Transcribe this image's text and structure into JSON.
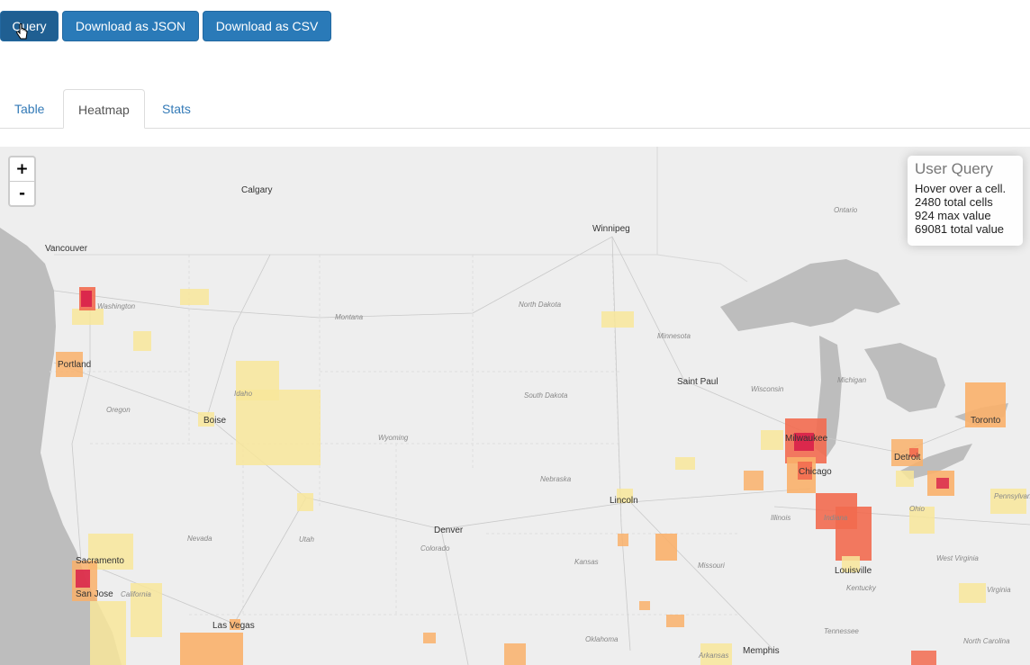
{
  "toolbar": {
    "query_label": "Query",
    "json_label": "Download as JSON",
    "csv_label": "Download as CSV"
  },
  "tabs": [
    {
      "label": "Table",
      "active": false
    },
    {
      "label": "Heatmap",
      "active": true
    },
    {
      "label": "Stats",
      "active": false
    }
  ],
  "map": {
    "zoom_in_label": "+",
    "zoom_out_label": "-",
    "info": {
      "title": "User Query",
      "hint": "Hover over a cell.",
      "cells": "2480 total cells",
      "max": "924 max value",
      "total": "69081 total value"
    },
    "cities": [
      "Calgary",
      "Winnipeg",
      "Vancouver",
      "Portland",
      "Boise",
      "Saint Paul",
      "Milwaukee",
      "Chicago",
      "Detroit",
      "Toronto",
      "Lincoln",
      "Denver",
      "Sacramento",
      "San Jose",
      "Las Vegas",
      "Louisville",
      "Memphis"
    ],
    "regions": [
      "Washington",
      "Montana",
      "North Dakota",
      "Minnesota",
      "Oregon",
      "Idaho",
      "South Dakota",
      "Wisconsin",
      "Michigan",
      "Wyoming",
      "Nebraska",
      "Nevada",
      "Utah",
      "Colorado",
      "Kansas",
      "Missouri",
      "Illinois",
      "Ohio",
      "Indiana",
      "Kentucky",
      "Tennessee",
      "Oklahoma",
      "Arkansas",
      "Ontario",
      "California",
      "Pennsylvania",
      "West Virginia",
      "Virginia",
      "North Carolina"
    ]
  },
  "colors": {
    "button": "#2a7ab8",
    "low": "#f8e69a",
    "mid": "#f9b06a",
    "high": "#f26a4f",
    "max": "#d81f4a",
    "land": "#eeeeee",
    "water": "#bdbdbd"
  }
}
